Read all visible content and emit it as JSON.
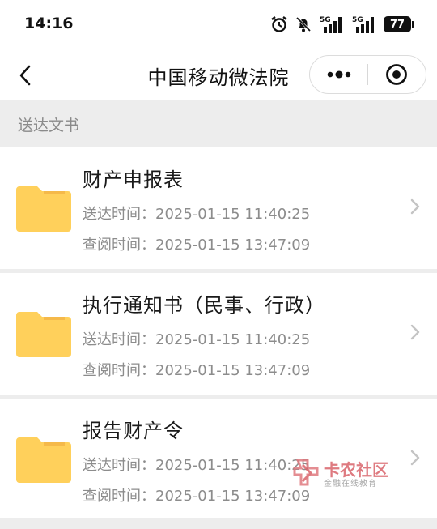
{
  "status_bar": {
    "time": "14:16",
    "icons": [
      "alarm-icon",
      "mute-bell-icon",
      "5g-signal-icon",
      "5g-signal-icon"
    ],
    "battery": "77"
  },
  "navbar": {
    "title": "中国移动微法院"
  },
  "section": {
    "title": "送达文书"
  },
  "documents": [
    {
      "title": "财产申报表",
      "delivered": "送达时间：2025-01-15 11:40:25",
      "viewed": "查阅时间：2025-01-15 13:47:09"
    },
    {
      "title": "执行通知书（民事、行政）",
      "delivered": "送达时间：2025-01-15 11:40:25",
      "viewed": "查阅时间：2025-01-15 13:47:09"
    },
    {
      "title": "报告财产令",
      "delivered": "送达时间：2025-01-15 11:40:25",
      "viewed": "查阅时间：2025-01-15 13:47:09"
    }
  ],
  "watermark": {
    "name": "卡农社区",
    "slogan": "金融在线教育"
  },
  "colors": {
    "folder": "#ffd05b",
    "folder_tab": "#f5b94a",
    "background": "#ededed",
    "watermark": "#d9636b"
  }
}
